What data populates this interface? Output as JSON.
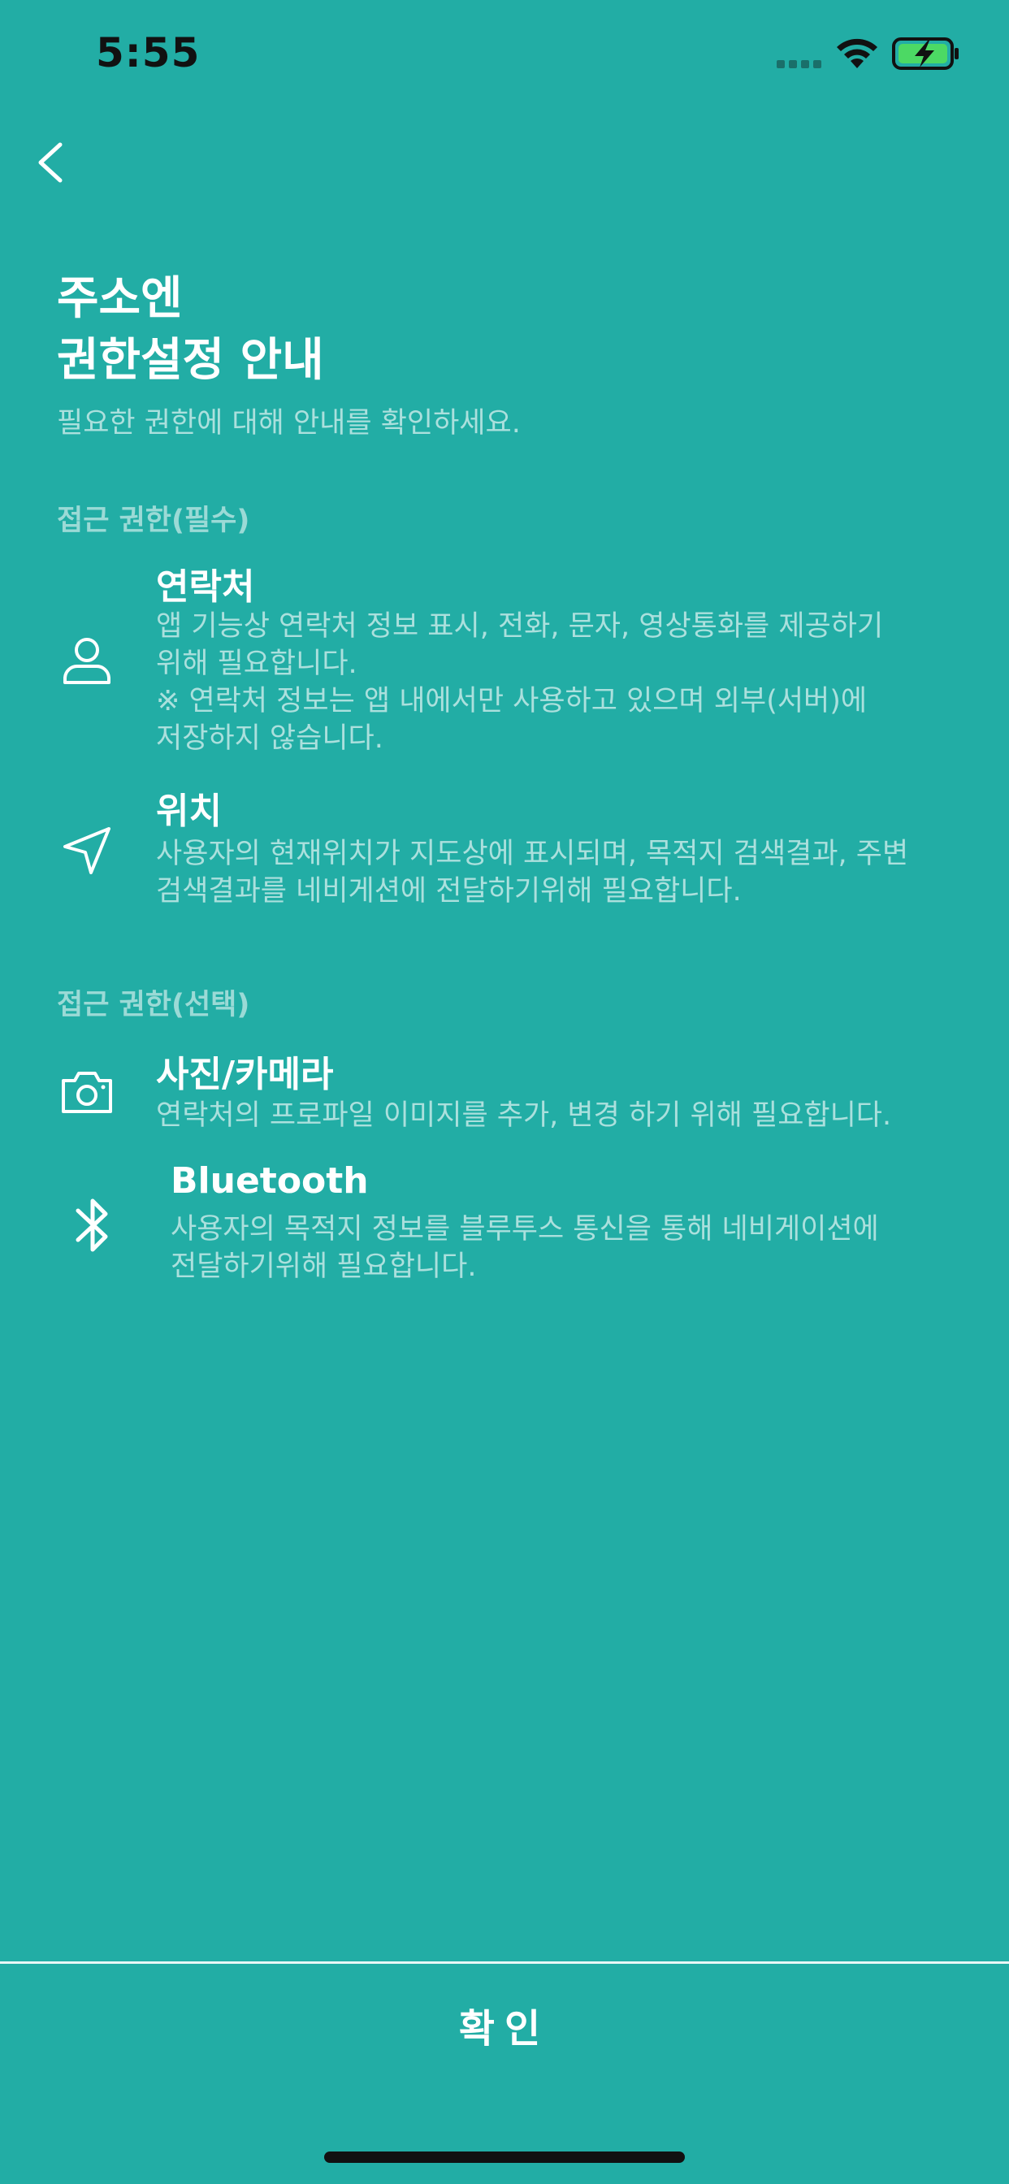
{
  "status_bar": {
    "time": "5:55",
    "signal_icon": "cellular-signal-icon",
    "wifi_icon": "wifi-icon",
    "battery_icon": "battery-charging-icon"
  },
  "nav": {
    "back_icon": "chevron-left-icon"
  },
  "header": {
    "title_line1": "주소엔",
    "title_line2": "권한설정 안내",
    "subtitle": "필요한 권한에 대해 안내를 확인하세요."
  },
  "required_section": {
    "header": "접근 권한(필수)",
    "items": [
      {
        "icon": "person-icon",
        "title": "연락처",
        "desc_lines": [
          "앱 기능상 연락처 정보 표시, 전화, 문자, 영상통화를 제공하기",
          "위해 필요합니다.",
          "※ 연락처 정보는 앱 내에서만 사용하고 있으며 외부(서버)에",
          "저장하지 않습니다."
        ]
      },
      {
        "icon": "location-arrow-icon",
        "title": "위치",
        "desc_lines": [
          "사용자의 현재위치가 지도상에 표시되며, 목적지 검색결과, 주변",
          "검색결과를 네비게션에 전달하기위해 필요합니다."
        ]
      }
    ]
  },
  "optional_section": {
    "header": "접근 권한(선택)",
    "items": [
      {
        "icon": "camera-icon",
        "title": "사진/카메라",
        "desc_lines": [
          "연락처의 프로파일 이미지를 추가, 변경 하기 위해 필요합니다."
        ]
      },
      {
        "icon": "bluetooth-icon",
        "title": "Bluetooth",
        "desc_lines": [
          "사용자의 목적지 정보를 블루투스 통신을 통해 네비게이션에",
          "전달하기위해 필요합니다."
        ]
      }
    ]
  },
  "footer": {
    "confirm_label": "확인"
  },
  "colors": {
    "background": "#22ADA5",
    "text_primary": "#FFFFFF",
    "battery_fill": "#4CD964"
  }
}
